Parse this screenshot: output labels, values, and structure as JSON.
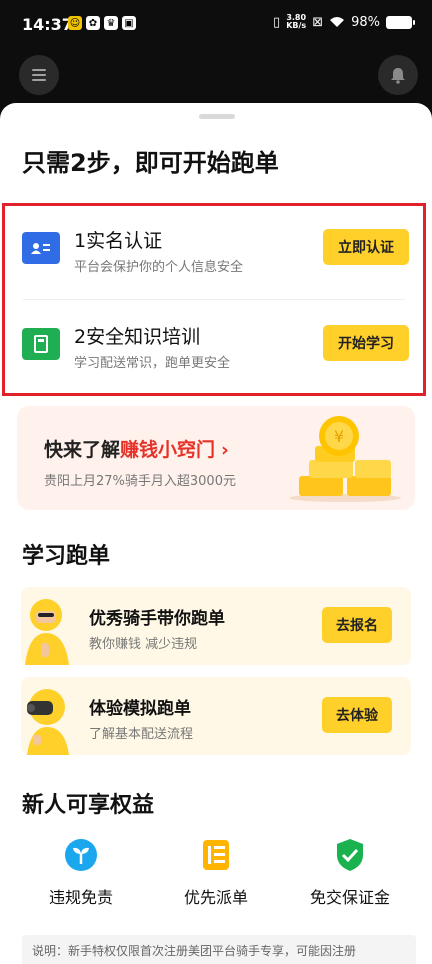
{
  "status_bar": {
    "time": "14:37",
    "net_speed_value": "3.80",
    "net_speed_unit": "KB/s",
    "battery": "98%",
    "icons": [
      "notification-app-icon",
      "grid-app-icon",
      "crown-app-icon",
      "store-app-icon",
      "vibrate-icon",
      "nfc-icon",
      "wifi-icon",
      "battery-icon"
    ]
  },
  "header": {
    "menu_icon": "menu-icon",
    "bell_icon": "bell-icon"
  },
  "sheet": {
    "title": "只需2步，即可开始跑单",
    "steps": [
      {
        "title": "1实名认证",
        "subtitle": "平台会保护你的个人信息安全",
        "button": "立即认证",
        "icon": "id-card-icon",
        "color": "#2f6ce5"
      },
      {
        "title": "2安全知识培训",
        "subtitle": "学习配送常识，跑单更安全",
        "button": "开始学习",
        "icon": "book-icon",
        "color": "#1fae52"
      }
    ],
    "promo": {
      "title_prefix": "快来了解",
      "title_highlight": "赚钱小窍门",
      "arrow": "›",
      "subtitle": "贵阳上月27%骑手月入超3000元",
      "image": "gold-coins-illustration"
    },
    "learn_section": {
      "title": "学习跑单",
      "cards": [
        {
          "title": "优秀骑手带你跑单",
          "subtitle": "教你赚钱 减少违规",
          "button": "去报名",
          "image": "rider-mentor-avatar"
        },
        {
          "title": "体验模拟跑单",
          "subtitle": "了解基本配送流程",
          "button": "去体验",
          "image": "vr-rider-avatar"
        }
      ]
    },
    "benefits_section": {
      "title": "新人可享权益",
      "items": [
        {
          "label": "违规免责",
          "icon": "sprout-icon",
          "color": "#1aa7ee"
        },
        {
          "label": "优先派单",
          "icon": "priority-list-icon",
          "color": "#ffb400"
        },
        {
          "label": "免交保证金",
          "icon": "shield-check-icon",
          "color": "#19b24f"
        }
      ]
    },
    "note": "说明：新手特权仅限首次注册美团平台骑手专享，可能因注册"
  },
  "colors": {
    "accent_yellow": "#ffd02a",
    "highlight_red": "#e5332a",
    "outline_red": "#e0212b"
  }
}
